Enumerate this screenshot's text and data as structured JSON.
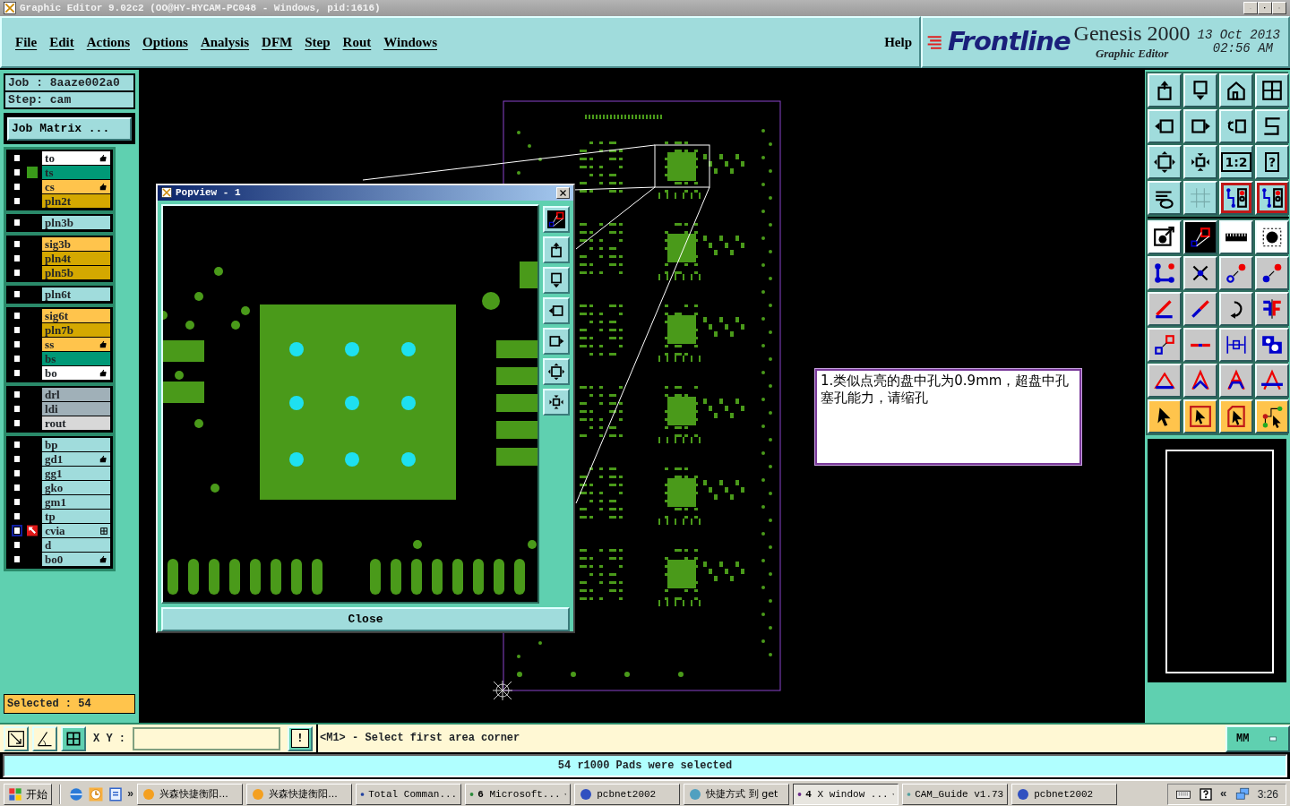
{
  "window": {
    "title": "Graphic Editor 9.02c2 (OO@HY-HYCAM-PC048 - Windows, pid:1616)"
  },
  "menu": [
    "File",
    "Edit",
    "Actions",
    "Options",
    "Analysis",
    "DFM",
    "Step",
    "Rout",
    "Windows"
  ],
  "help": "Help",
  "branding": {
    "logo": "Frontline",
    "product": "Genesis 2000",
    "subtitle": "Graphic Editor",
    "date": "13 Oct 2013",
    "time": "02:56 AM"
  },
  "job": {
    "job": "Job : 8aaze002a0",
    "step": "Step: cam",
    "matrix_button": "Job Matrix ..."
  },
  "layer_groups": [
    [
      {
        "name": "to",
        "color": "#ffffff",
        "checked": false,
        "displayed": false,
        "work": false,
        "hand": true
      },
      {
        "name": "ts",
        "color": "#009977",
        "checked": false,
        "displayed": true,
        "work": false,
        "hand": false
      },
      {
        "name": "cs",
        "color": "#ffc44c",
        "checked": false,
        "displayed": false,
        "work": false,
        "hand": true
      },
      {
        "name": "pln2t",
        "color": "#d4a800",
        "checked": false,
        "displayed": false,
        "work": false,
        "hand": false
      }
    ],
    [
      {
        "name": "pln3b",
        "color": "#a0dcdc",
        "checked": false,
        "displayed": false,
        "work": false,
        "hand": false
      }
    ],
    [
      {
        "name": "sig3b",
        "color": "#ffc44c",
        "checked": false,
        "displayed": false,
        "work": false,
        "hand": false
      },
      {
        "name": "pln4t",
        "color": "#d4a800",
        "checked": false,
        "displayed": false,
        "work": false,
        "hand": false
      },
      {
        "name": "pln5b",
        "color": "#d4a800",
        "checked": false,
        "displayed": false,
        "work": false,
        "hand": false
      }
    ],
    [
      {
        "name": "pln6t",
        "color": "#a0dcdc",
        "checked": false,
        "displayed": false,
        "work": false,
        "hand": false
      }
    ],
    [
      {
        "name": "sig6t",
        "color": "#ffc44c",
        "checked": false,
        "displayed": false,
        "work": false,
        "hand": false
      },
      {
        "name": "pln7b",
        "color": "#d4a800",
        "checked": false,
        "displayed": false,
        "work": false,
        "hand": false
      },
      {
        "name": "ss",
        "color": "#ffc44c",
        "checked": false,
        "displayed": false,
        "work": false,
        "hand": true
      },
      {
        "name": "bs",
        "color": "#009977",
        "checked": false,
        "displayed": false,
        "work": false,
        "hand": false
      },
      {
        "name": "bo",
        "color": "#ffffff",
        "checked": false,
        "displayed": false,
        "work": false,
        "hand": true
      }
    ],
    [
      {
        "name": "drl",
        "color": "#a0b0b8",
        "checked": false,
        "displayed": false,
        "work": false,
        "hand": false
      },
      {
        "name": "ldi",
        "color": "#a0b0b8",
        "checked": false,
        "displayed": false,
        "work": false,
        "hand": false
      },
      {
        "name": "rout",
        "color": "#d8d8d8",
        "checked": false,
        "displayed": false,
        "work": false,
        "hand": false
      }
    ],
    [
      {
        "name": "bp",
        "color": "#a0dcdc",
        "checked": false,
        "displayed": false,
        "work": false,
        "hand": false
      },
      {
        "name": "gd1",
        "color": "#a0dcdc",
        "checked": false,
        "displayed": false,
        "work": false,
        "hand": true
      },
      {
        "name": "gg1",
        "color": "#a0dcdc",
        "checked": false,
        "displayed": false,
        "work": false,
        "hand": false
      },
      {
        "name": "gko",
        "color": "#a0dcdc",
        "checked": false,
        "displayed": false,
        "work": false,
        "hand": false
      },
      {
        "name": "gm1",
        "color": "#a0dcdc",
        "checked": false,
        "displayed": false,
        "work": false,
        "hand": false
      },
      {
        "name": "tp",
        "color": "#a0dcdc",
        "checked": false,
        "displayed": false,
        "work": false,
        "hand": false
      },
      {
        "name": "cvia",
        "color": "#a0dcdc",
        "checked": false,
        "displayed": false,
        "work": true,
        "hand": false
      },
      {
        "name": "d",
        "color": "#a0dcdc",
        "checked": false,
        "displayed": false,
        "work": false,
        "hand": false
      },
      {
        "name": "bo0",
        "color": "#a0dcdc",
        "checked": false,
        "displayed": false,
        "work": false,
        "hand": true
      }
    ]
  ],
  "selected_count": "Selected : 54",
  "popview": {
    "title": "Popview - 1",
    "close_label": "Close"
  },
  "note": "1.类似点亮的盘中孔为0.9mm，超盘中孔塞孔能力，请缩孔",
  "toolbar": {
    "rows": [
      {
        "kind": "cyan",
        "buttons": [
          {
            "highlighted": false
          },
          {
            "highlighted": false
          },
          {
            "highlighted": false
          },
          {
            "highlighted": false
          }
        ]
      },
      {
        "kind": "cyan",
        "buttons": [
          {
            "highlighted": false
          },
          {
            "highlighted": false
          },
          {
            "highlighted": false
          },
          {
            "highlighted": false
          }
        ]
      },
      {
        "kind": "cyan",
        "buttons": [
          {
            "highlighted": false
          },
          {
            "highlighted": false
          },
          {
            "highlighted": false,
            "label": "1:2"
          },
          {
            "highlighted": false,
            "label": "?"
          }
        ]
      },
      {
        "kind": "cyan",
        "buttons": [
          {
            "highlighted": false
          },
          {
            "highlighted": false
          },
          {
            "highlighted": true
          },
          {
            "highlighted": true
          }
        ]
      },
      {
        "kind": "white",
        "buttons": [
          {
            "highlighted": false
          },
          {
            "highlighted": false
          },
          {
            "highlighted": false
          },
          {
            "highlighted": false
          }
        ]
      },
      {
        "kind": "grey",
        "buttons": [
          {
            "highlighted": false
          },
          {
            "highlighted": false
          },
          {
            "highlighted": false
          },
          {
            "highlighted": false
          }
        ]
      },
      {
        "kind": "grey",
        "buttons": [
          {
            "highlighted": false
          },
          {
            "highlighted": false
          },
          {
            "highlighted": false
          },
          {
            "highlighted": false
          }
        ]
      },
      {
        "kind": "grey",
        "buttons": [
          {
            "highlighted": false
          },
          {
            "highlighted": false
          },
          {
            "highlighted": false
          },
          {
            "highlighted": false
          }
        ]
      },
      {
        "kind": "grey",
        "buttons": [
          {
            "highlighted": false
          },
          {
            "highlighted": false
          },
          {
            "highlighted": false
          },
          {
            "highlighted": false
          }
        ]
      },
      {
        "kind": "orange",
        "buttons": [
          {
            "highlighted": false
          },
          {
            "highlighted": false
          },
          {
            "highlighted": false
          },
          {
            "highlighted": false
          }
        ]
      }
    ]
  },
  "command": {
    "coord_label": "X Y :",
    "alert": "!",
    "prompt": "<M1> - Select first area corner",
    "units": "MM"
  },
  "status": "54 r1000 Pads were selected",
  "taskbar": {
    "start": "开始",
    "more": "»",
    "tasks": [
      {
        "label": "兴森快捷衡阳...",
        "active": false,
        "grouped": false
      },
      {
        "label": "兴森快捷衡阳...",
        "active": false,
        "grouped": false
      },
      {
        "label": "Total Comman...",
        "active": false,
        "grouped": false
      },
      {
        "label": "**6** Microsoft...",
        "active": false,
        "grouped": true
      },
      {
        "label": "pcbnet2002",
        "active": false,
        "grouped": false
      },
      {
        "label": "快捷方式 到 get",
        "active": false,
        "grouped": false
      },
      {
        "label": "**4** X window ...",
        "active": true,
        "grouped": true
      },
      {
        "label": "CAM_Guide v1.73",
        "active": false,
        "grouped": false
      },
      {
        "label": "pcbnet2002",
        "active": false,
        "grouped": false
      }
    ],
    "tray_more": "«",
    "clock": "3:26"
  }
}
